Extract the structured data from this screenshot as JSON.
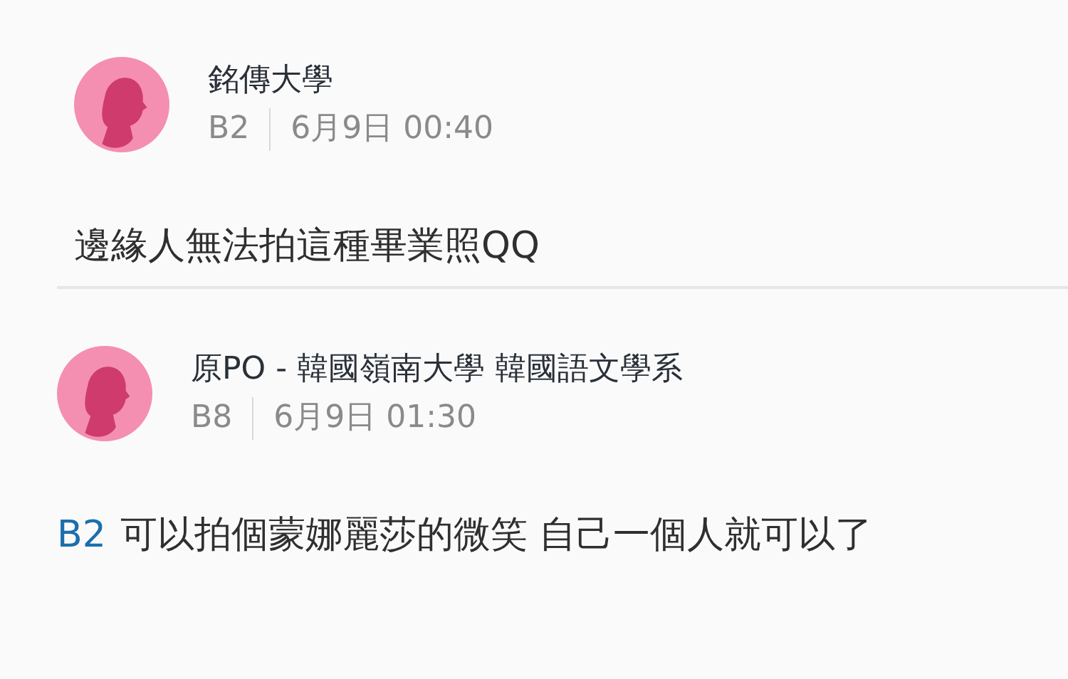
{
  "comments": [
    {
      "author": "銘傳大學",
      "floor": "B2",
      "time": "6月9日 00:40",
      "body": "邊緣人無法拍這種畢業照QQ"
    },
    {
      "author": "原PO - 韓國嶺南大學 韓國語文學系",
      "floor": "B8",
      "time": "6月9日 01:30",
      "mention": "B2",
      "body": "可以拍個蒙娜麗莎的微笑 自己一個人就可以了"
    }
  ]
}
